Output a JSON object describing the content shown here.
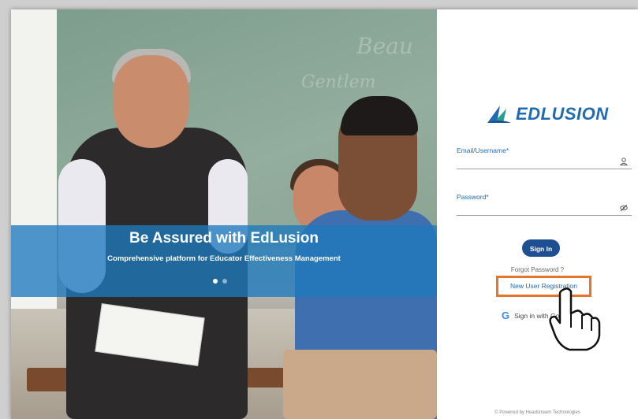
{
  "hero": {
    "chalkboard_text": [
      "Beau",
      "Gentlem"
    ],
    "banner_title": "Be Assured with EdLusion",
    "banner_subtitle": "Comprehensive platform for Educator Effectiveness Management",
    "carousel_dots": 2,
    "active_dot": 0
  },
  "login": {
    "logo_text": "EDLUSION",
    "email_label": "Email/Username*",
    "email_icon": "user-icon",
    "password_label": "Password*",
    "password_icon": "eye-slash-icon",
    "signin_label": "Sign In",
    "forgot_label": "Forgot Password ?",
    "new_user_label": "New User Registration",
    "google_icon": "G",
    "google_label": "Sign in with Go",
    "footer": "© Powered by Headstream Technologies"
  },
  "colors": {
    "brand_blue": "#1f6bb3",
    "button_blue": "#1f4f93",
    "highlight_orange": "#e8742a",
    "banner_blue": "#1e7abe"
  }
}
